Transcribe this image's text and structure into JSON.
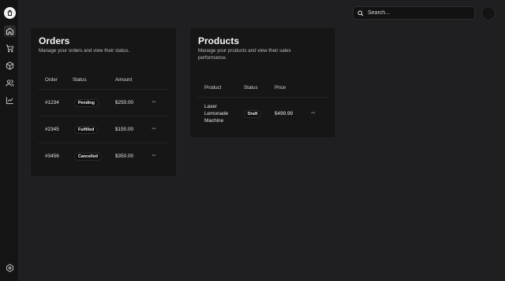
{
  "header": {
    "search_placeholder": "Search..."
  },
  "sidebar": {
    "icons": [
      "logo-bag-icon",
      "home-icon",
      "cart-icon",
      "package-icon",
      "users-icon",
      "line-chart-icon",
      "settings-icon"
    ]
  },
  "orders": {
    "title": "Orders",
    "description": "Manage your orders and view their status.",
    "columns": [
      "Order",
      "Status",
      "Amount"
    ],
    "rows": [
      {
        "order": "#1234",
        "status": "Pending",
        "amount": "$250.00",
        "action": "⇔"
      },
      {
        "order": "#2345",
        "status": "Fulfilled",
        "amount": "$150.00",
        "action": "⇔"
      },
      {
        "order": "#3456",
        "status": "Cancelled",
        "amount": "$350.00",
        "action": "⇔"
      }
    ]
  },
  "products": {
    "title": "Products",
    "description_line1": "Manage your products and view their sales",
    "description_line2": "performance.",
    "columns": [
      "Product",
      "Status",
      "Price"
    ],
    "rows": [
      {
        "product_line1": "Laser",
        "product_line2": "Lemonade",
        "product_line3": "Machine",
        "status": "Draft",
        "price": "$499.99",
        "action": "⇔"
      }
    ]
  },
  "colors": {
    "background": "#1f1f21",
    "card": "#161617",
    "sidebar": "#141415"
  }
}
